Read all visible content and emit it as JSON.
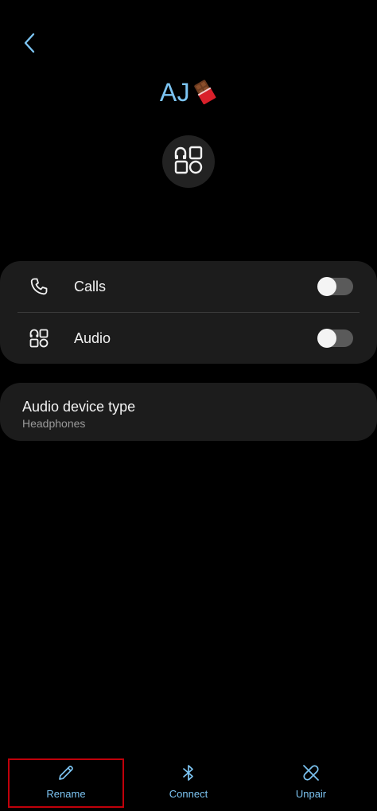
{
  "header": {
    "back_icon": "chevron-left-icon",
    "device_name": "AJ",
    "device_emoji_icon": "chocolate-bar-icon",
    "device_type_icon": "audio-devices-icon"
  },
  "settings": {
    "items": [
      {
        "label": "Calls",
        "icon": "phone-icon",
        "enabled": false
      },
      {
        "label": "Audio",
        "icon": "audio-grid-icon",
        "enabled": false
      }
    ]
  },
  "device_type": {
    "title": "Audio device type",
    "value": "Headphones"
  },
  "bottom_bar": {
    "rename_label": "Rename",
    "connect_label": "Connect",
    "unpair_label": "Unpair"
  },
  "colors": {
    "accent": "#7cc4f2",
    "background": "#000000",
    "card": "#1c1c1c",
    "highlight": "#c0000a"
  }
}
